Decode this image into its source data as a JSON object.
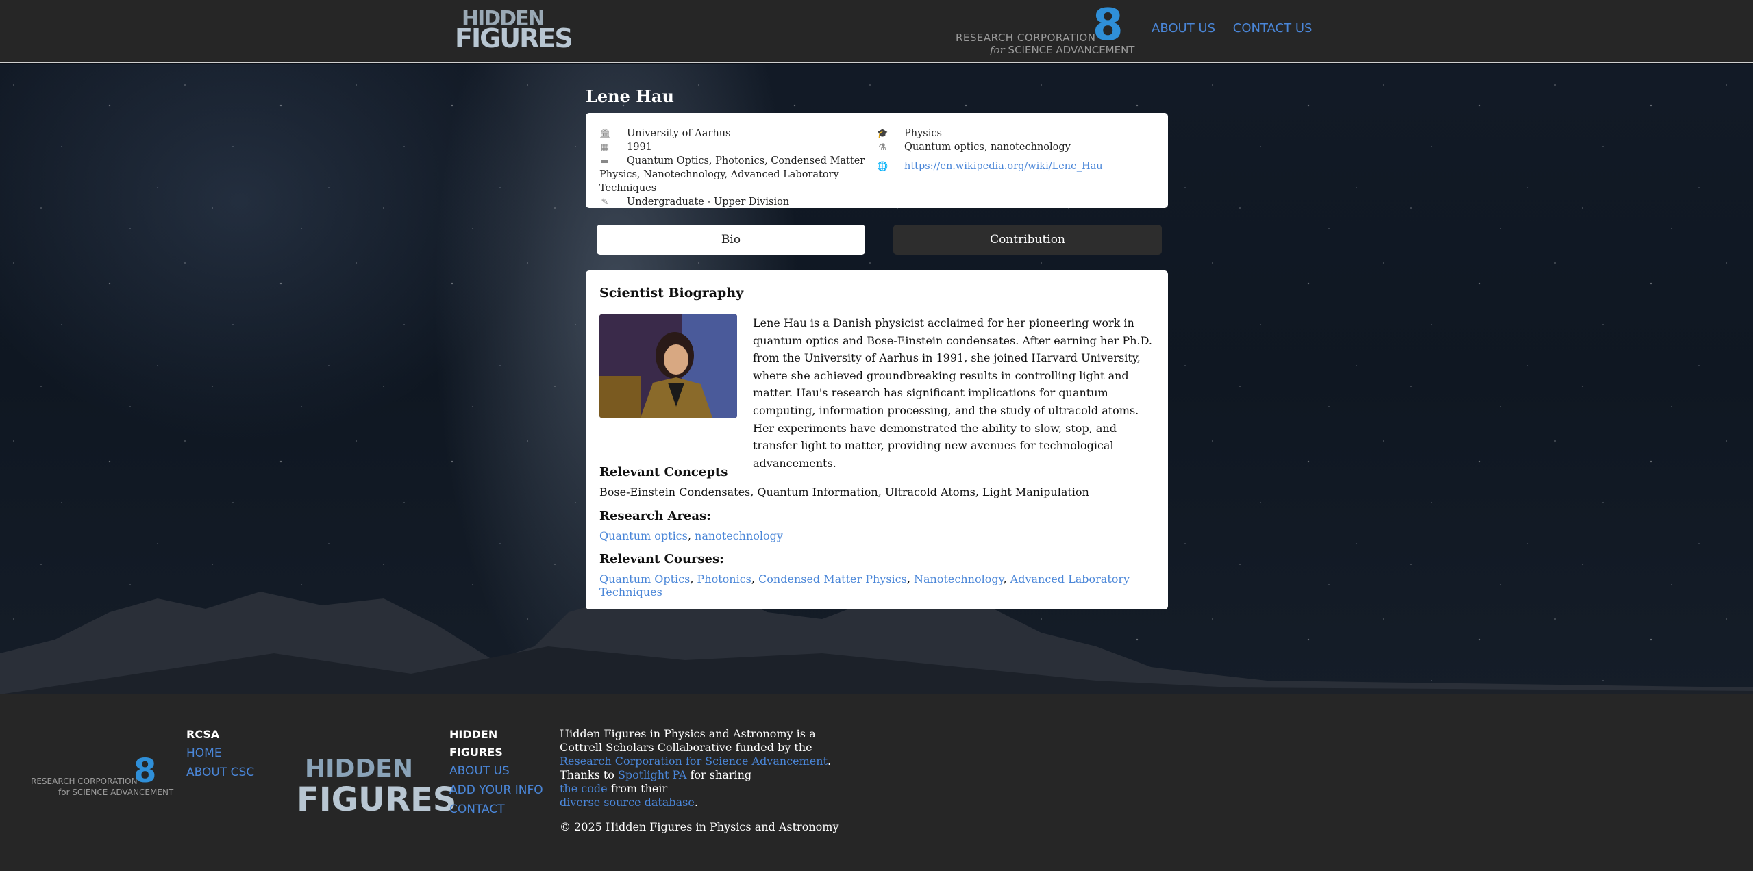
{
  "header": {
    "logo_top": "HIDDEN",
    "logo_bottom": "FIGURES",
    "rc_line1": "RESEARCH CORPORATION",
    "rc_line2_for": "for",
    "rc_line2": "SCIENCE ADVANCEMENT",
    "rc_mark": "8",
    "nav": [
      "ABOUT US",
      "CONTACT US"
    ]
  },
  "scientist": {
    "name": "Lene Hau",
    "institution": "University of Aarhus",
    "year": "1991",
    "courses_list": "Quantum Optics, Photonics, Condensed Matter Physics, Nanotechnology, Advanced Laboratory Techniques",
    "level": "Undergraduate - Upper Division",
    "field": "Physics",
    "areas_list": "Quantum optics, nanotechnology",
    "url": "https://en.wikipedia.org/wiki/Lene_Hau"
  },
  "tabs": {
    "bio": "Bio",
    "contribution": "Contribution"
  },
  "bio": {
    "title": "Scientist Biography",
    "text": "Lene Hau is a Danish physicist acclaimed for her pioneering work in quantum optics and Bose-Einstein condensates. After earning her Ph.D. from the University of Aarhus in 1991, she joined Harvard University, where she achieved groundbreaking results in controlling light and matter. Hau's research has significant implications for quantum computing, information processing, and the study of ultracold atoms. Her experiments have demonstrated the ability to slow, stop, and transfer light to matter, providing new avenues for technological advancements.",
    "concepts_h": "Relevant Concepts",
    "concepts": "Bose-Einstein Condensates, Quantum Information, Ultracold Atoms, Light Manipulation",
    "areas_h": "Research Areas:",
    "areas": [
      "Quantum optics",
      "nanotechnology"
    ],
    "courses_h": "Relevant Courses:",
    "courses": [
      "Quantum Optics",
      "Photonics",
      "Condensed Matter Physics",
      "Nanotechnology",
      "Advanced Laboratory Techniques"
    ]
  },
  "footer": {
    "rc_line1": "RESEARCH CORPORATION",
    "rc_line2": "for SCIENCE ADVANCEMENT",
    "rc_mark": "8",
    "rcsa_h": "RCSA",
    "rcsa_links": [
      "HOME",
      "ABOUT CSC"
    ],
    "hf_top": "HIDDEN",
    "hf_bottom": "FIGURES",
    "hf_h": "HIDDEN FIGURES",
    "hf_links": [
      "ABOUT US",
      "ADD YOUR INFO",
      "CONTACT"
    ],
    "about_1": "Hidden Figures in Physics and Astronomy is a Cottrell Scholars Collaborative funded by the",
    "about_link1": "Research Corporation for Science Advancement",
    "about_2": "Thanks to",
    "about_link2": "Spotlight PA",
    "about_3": "for sharing",
    "about_link3": "the code",
    "about_4": "from their",
    "about_link4": "diverse source database",
    "copyright": "© 2025 Hidden Figures in Physics and Astronomy"
  }
}
